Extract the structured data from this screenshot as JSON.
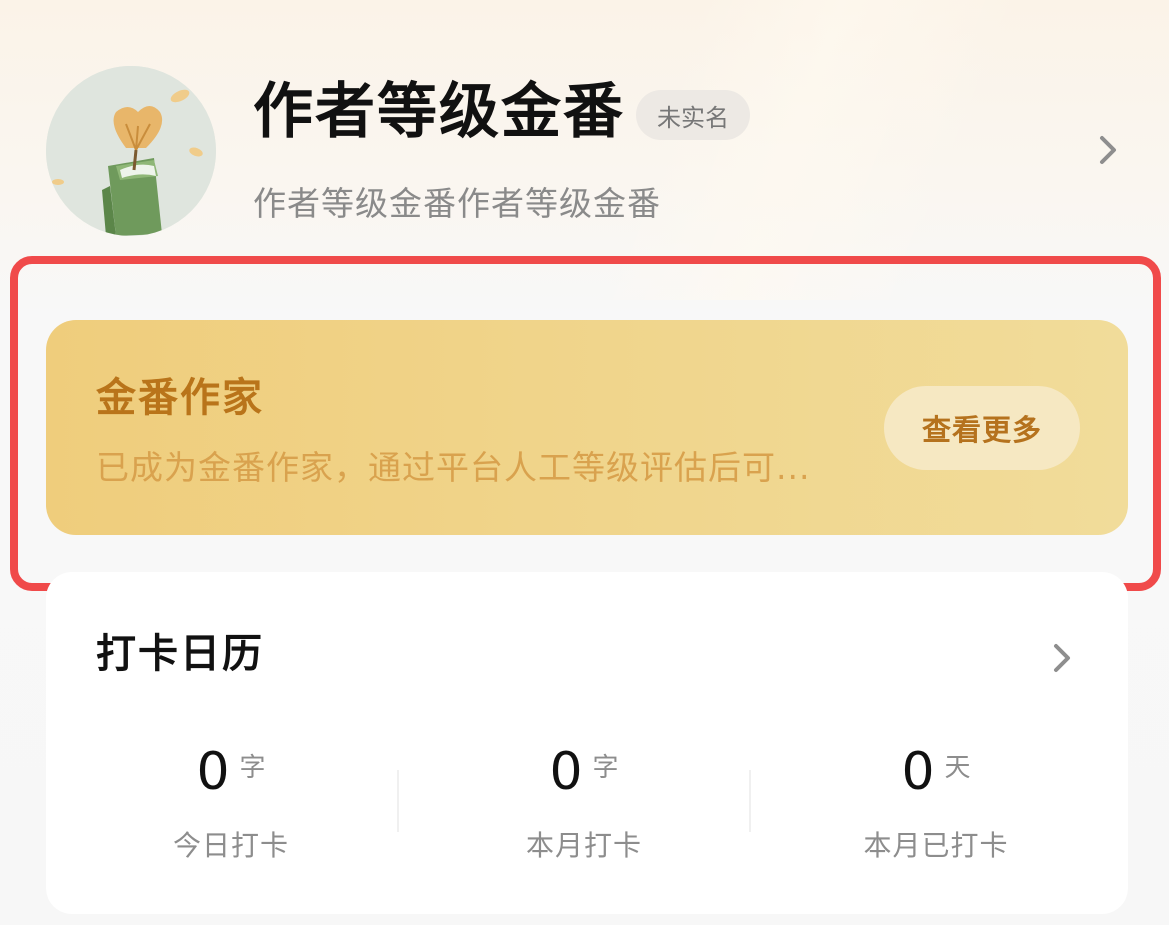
{
  "profile": {
    "name": "作者等级金番",
    "badge": "未实名",
    "subtitle": "作者等级金番作者等级金番"
  },
  "level_card": {
    "title": "金番作家",
    "description": "已成为金番作家，通过平台人工等级评估后可...",
    "button_label": "查看更多"
  },
  "checkin": {
    "title": "打卡日历",
    "stats": [
      {
        "value": "0",
        "unit": "字",
        "label": "今日打卡"
      },
      {
        "value": "0",
        "unit": "字",
        "label": "本月打卡"
      },
      {
        "value": "0",
        "unit": "天",
        "label": "本月已打卡"
      }
    ]
  },
  "colors": {
    "highlight_border": "#f04a4a",
    "gold_title": "#b9741a",
    "gold_desc": "#d9a24e",
    "card_gradient_start": "#efcd7c",
    "card_gradient_end": "#f1dc9a"
  },
  "icons": {
    "avatar": "ginkgo-leaf-book-illustration",
    "profile_arrow": "chevron-right-icon",
    "calendar_arrow": "chevron-right-icon"
  }
}
